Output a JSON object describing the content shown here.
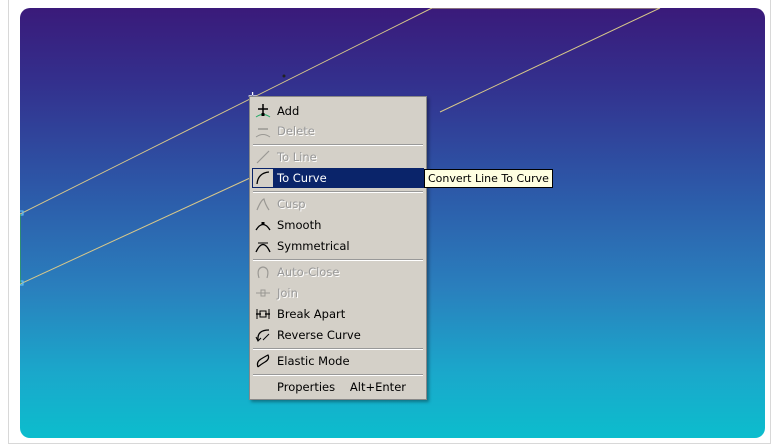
{
  "menu": {
    "items": [
      {
        "label": "Add",
        "enabled": true,
        "icon": "add-node-icon"
      },
      {
        "label": "Delete",
        "enabled": false,
        "icon": "delete-node-icon"
      },
      {
        "label": "To Line",
        "enabled": false,
        "icon": "to-line-icon"
      },
      {
        "label": "To Curve",
        "enabled": true,
        "highlighted": true,
        "icon": "to-curve-icon"
      },
      {
        "label": "Cusp",
        "enabled": false,
        "icon": "cusp-icon"
      },
      {
        "label": "Smooth",
        "enabled": true,
        "icon": "smooth-icon"
      },
      {
        "label": "Symmetrical",
        "enabled": true,
        "icon": "symmetrical-icon"
      },
      {
        "label": "Auto-Close",
        "enabled": false,
        "icon": "auto-close-icon"
      },
      {
        "label": "Join",
        "enabled": false,
        "icon": "join-icon"
      },
      {
        "label": "Break Apart",
        "enabled": true,
        "icon": "break-apart-icon"
      },
      {
        "label": "Reverse Curve",
        "enabled": true,
        "icon": "reverse-curve-icon"
      },
      {
        "label": "Elastic Mode",
        "enabled": true,
        "icon": "elastic-mode-icon"
      },
      {
        "label": "Properties",
        "shortcut": "Alt+Enter",
        "enabled": true
      }
    ]
  },
  "tooltip": {
    "text": "Convert Line To Curve"
  },
  "colors": {
    "highlight": "#0a246a",
    "menu_bg": "#d4d0c8",
    "gradient_top": "#3a1a7a",
    "gradient_bottom": "#0cbdcd",
    "guide_line": "#d8c88a"
  }
}
